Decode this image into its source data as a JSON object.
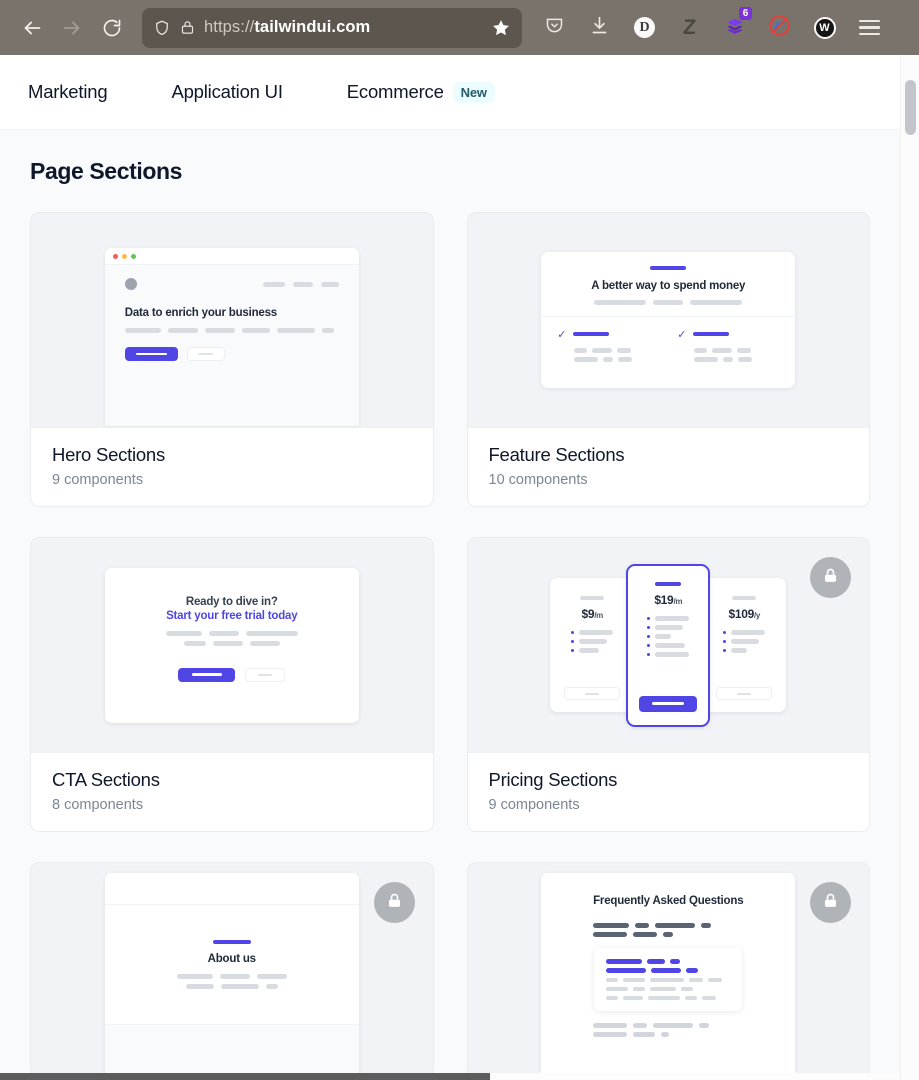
{
  "browser": {
    "back_icon": "arrow-left-icon",
    "forward_icon": "arrow-right-icon",
    "reload_icon": "reload-icon",
    "shield_icon": "shield-icon",
    "lock_icon": "padlock-icon",
    "url_scheme": "https://",
    "url_host": "tailwindui.com",
    "bookmark_icon": "star-icon",
    "extensions": [
      {
        "name": "pocket-icon",
        "label": ""
      },
      {
        "name": "downloads-icon",
        "label": ""
      },
      {
        "name": "dictionary-extension-icon",
        "label": "D"
      },
      {
        "name": "zotero-extension-icon",
        "label": "Z"
      },
      {
        "name": "layers-extension-icon",
        "label": "",
        "badge": "6"
      },
      {
        "name": "blocker-extension-icon",
        "label": ""
      },
      {
        "name": "wallet-extension-icon",
        "label": "W"
      }
    ],
    "menu_icon": "hamburger-menu-icon"
  },
  "tabs": [
    {
      "label": "Marketing",
      "badge": null
    },
    {
      "label": "Application UI",
      "badge": null
    },
    {
      "label": "Ecommerce",
      "badge": "New"
    }
  ],
  "page": {
    "title": "Page Sections"
  },
  "colors": {
    "indigo": "#4f46e5",
    "badge_bg": "#ecfdff",
    "badge_text": "#295b6b",
    "page_bg": "#f8fafc",
    "card_bg": "#f1f3f6",
    "lock_bg": "#b0b3b8"
  },
  "cards": [
    {
      "title": "Hero Sections",
      "components": "9 components",
      "locked": false,
      "preview": {
        "kind": "hero",
        "heading": "Data to enrich your business"
      }
    },
    {
      "title": "Feature Sections",
      "components": "10 components",
      "locked": false,
      "preview": {
        "kind": "feature",
        "heading": "A better way to spend money"
      }
    },
    {
      "title": "CTA Sections",
      "components": "8 components",
      "locked": false,
      "preview": {
        "kind": "cta",
        "line1": "Ready to dive in?",
        "line2": "Start your free trial today"
      }
    },
    {
      "title": "Pricing Sections",
      "components": "9 components",
      "locked": true,
      "lock_icon": "lock-icon",
      "preview": {
        "kind": "pricing",
        "plans": [
          {
            "price": "$9",
            "period": "/m",
            "featured": false
          },
          {
            "price": "$19",
            "period": "/m",
            "featured": true
          },
          {
            "price": "$109",
            "period": "/y",
            "featured": false
          }
        ]
      }
    },
    {
      "title": "",
      "components": "",
      "locked": true,
      "lock_icon": "lock-icon",
      "preview": {
        "kind": "about",
        "heading": "About us"
      }
    },
    {
      "title": "",
      "components": "",
      "locked": true,
      "lock_icon": "lock-icon",
      "preview": {
        "kind": "faq",
        "heading": "Frequently Asked Questions"
      }
    }
  ]
}
